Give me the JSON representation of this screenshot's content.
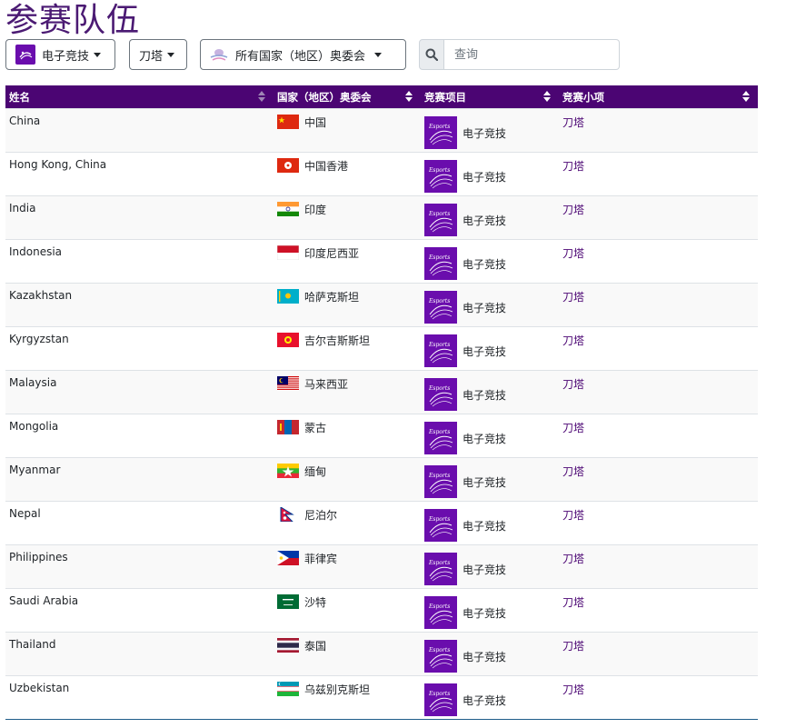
{
  "page": {
    "title": "参赛队伍"
  },
  "filters": {
    "sport_label": "电子竞技",
    "event_label": "刀塔",
    "noc_label": "所有国家（地区）奥委会",
    "search_placeholder": "查询"
  },
  "table": {
    "headers": [
      "姓名",
      "国家（地区）奥委会",
      "竞赛项目",
      "竞赛小项"
    ],
    "rows": [
      {
        "name": "China",
        "noc": "中国",
        "flag": "chn",
        "sport": "电子竞技",
        "event": "刀塔"
      },
      {
        "name": "Hong Kong, China",
        "noc": "中国香港",
        "flag": "hkg",
        "sport": "电子竞技",
        "event": "刀塔"
      },
      {
        "name": "India",
        "noc": "印度",
        "flag": "ind",
        "sport": "电子竞技",
        "event": "刀塔"
      },
      {
        "name": "Indonesia",
        "noc": "印度尼西亚",
        "flag": "ina",
        "sport": "电子竞技",
        "event": "刀塔"
      },
      {
        "name": "Kazakhstan",
        "noc": "哈萨克斯坦",
        "flag": "kaz",
        "sport": "电子竞技",
        "event": "刀塔"
      },
      {
        "name": "Kyrgyzstan",
        "noc": "吉尔吉斯斯坦",
        "flag": "kgz",
        "sport": "电子竞技",
        "event": "刀塔"
      },
      {
        "name": "Malaysia",
        "noc": "马来西亚",
        "flag": "mas",
        "sport": "电子竞技",
        "event": "刀塔"
      },
      {
        "name": "Mongolia",
        "noc": "蒙古",
        "flag": "mgl",
        "sport": "电子竞技",
        "event": "刀塔"
      },
      {
        "name": "Myanmar",
        "noc": "缅甸",
        "flag": "mya",
        "sport": "电子竞技",
        "event": "刀塔"
      },
      {
        "name": "Nepal",
        "noc": "尼泊尔",
        "flag": "nep",
        "sport": "电子竞技",
        "event": "刀塔"
      },
      {
        "name": "Philippines",
        "noc": "菲律宾",
        "flag": "phi",
        "sport": "电子竞技",
        "event": "刀塔"
      },
      {
        "name": "Saudi Arabia",
        "noc": "沙特",
        "flag": "ksa",
        "sport": "电子竞技",
        "event": "刀塔"
      },
      {
        "name": "Thailand",
        "noc": "泰国",
        "flag": "tha",
        "sport": "电子竞技",
        "event": "刀塔"
      },
      {
        "name": "Uzbekistan",
        "noc": "乌兹别克斯坦",
        "flag": "uzb",
        "sport": "电子竞技",
        "event": "刀塔"
      }
    ]
  },
  "colors": {
    "brand_purple": "#4b0573",
    "sport_tile": "#6a0dad",
    "title": "#4b1a73"
  },
  "icons": {
    "search": "search-icon",
    "sport": "esports-icon",
    "noc": "olympic-council-icon",
    "dropdown": "caret-down-icon"
  }
}
